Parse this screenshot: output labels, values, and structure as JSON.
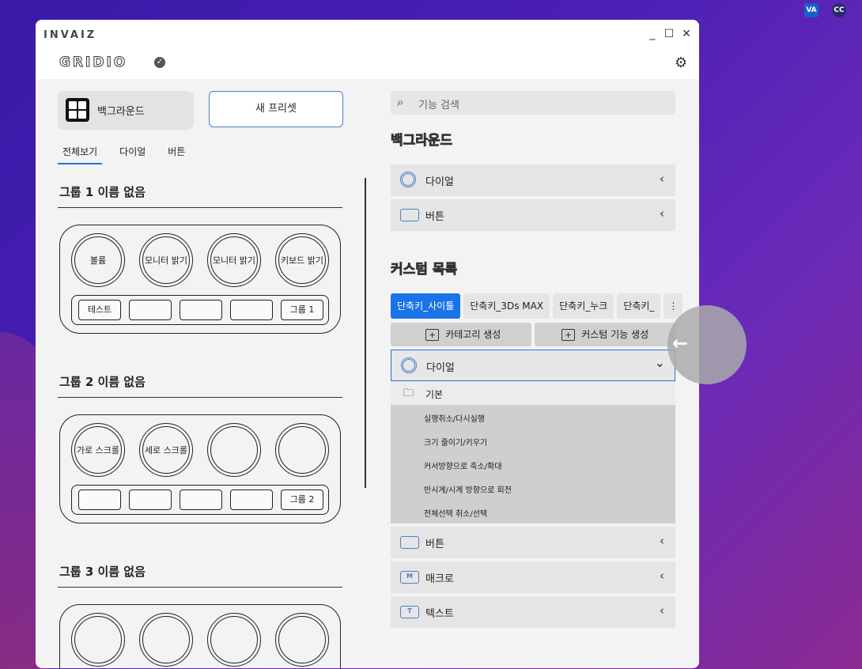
{
  "app": {
    "brand": "INVAIZ",
    "logo": "GRIDIO",
    "check": "✓",
    "settings_icon": "⚙"
  },
  "window_controls": {
    "minimize": "_",
    "maximize": "☐",
    "close": "✕"
  },
  "left": {
    "background_label": "백그라운드",
    "new_preset": "새 프리셋",
    "tabs": [
      "전체보기",
      "다이얼",
      "버튼"
    ],
    "groups": [
      {
        "title": "그룹 1   이름 없음",
        "knobs": [
          "볼륨",
          "모니터 밝기",
          "모니터 밝기",
          "키보드 밝기"
        ],
        "buttons": [
          "테스트",
          "",
          "",
          "",
          "그룹 1"
        ]
      },
      {
        "title": "그룹 2   이름 없음",
        "knobs": [
          "가로 스크롤",
          "세로 스크롤",
          "",
          ""
        ],
        "buttons": [
          "",
          "",
          "",
          "",
          "그룹 2"
        ]
      },
      {
        "title": "그룹 3   이름 없음",
        "knobs": [
          "",
          "",
          "",
          ""
        ],
        "buttons": []
      }
    ]
  },
  "right": {
    "search_placeholder": "기능 검색",
    "section_background": "백그라운드",
    "bg_rows": [
      "다이얼",
      "버튼"
    ],
    "section_custom": "커스텀 목록",
    "custom_tabs": [
      "단축키_사이툴",
      "단축키_3Ds MAX",
      "단축키_누크",
      "단축키_"
    ],
    "more_icon": "⋮",
    "create_category": "카테고리 생성",
    "create_custom": "커스텀 기능 생성",
    "dial_open": "다이얼",
    "folder": "기본",
    "folder_items": [
      "실행취소/다시실행",
      "크기 줄이기/키우기",
      "커서방향으로 축소/확대",
      "반시계/시계 방향으로 회전",
      "전체선택 취소/선택"
    ],
    "rows": [
      {
        "label": "버튼",
        "badge": ""
      },
      {
        "label": "매크로",
        "badge": "M"
      },
      {
        "label": "텍스트",
        "badge": "T"
      }
    ],
    "chevron_left": "‹",
    "chevron_down": "⌄"
  },
  "tray": {
    "va": "VA",
    "cc": "CC"
  },
  "back_arrow": "←",
  "colors": {
    "accent": "#1a73e8",
    "outline_blue": "#4a80c8",
    "window_bg": "#f3f3f3"
  }
}
